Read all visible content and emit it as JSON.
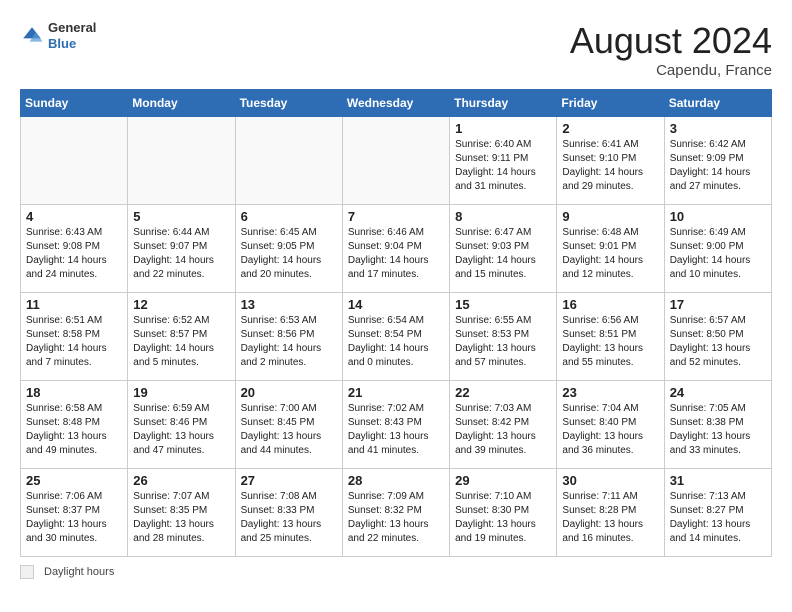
{
  "header": {
    "logo": {
      "general": "General",
      "blue": "Blue"
    },
    "month_year": "August 2024",
    "location": "Capendu, France"
  },
  "days_of_week": [
    "Sunday",
    "Monday",
    "Tuesday",
    "Wednesday",
    "Thursday",
    "Friday",
    "Saturday"
  ],
  "weeks": [
    [
      {
        "day": "",
        "info": ""
      },
      {
        "day": "",
        "info": ""
      },
      {
        "day": "",
        "info": ""
      },
      {
        "day": "",
        "info": ""
      },
      {
        "day": "1",
        "info": "Sunrise: 6:40 AM\nSunset: 9:11 PM\nDaylight: 14 hours and 31 minutes."
      },
      {
        "day": "2",
        "info": "Sunrise: 6:41 AM\nSunset: 9:10 PM\nDaylight: 14 hours and 29 minutes."
      },
      {
        "day": "3",
        "info": "Sunrise: 6:42 AM\nSunset: 9:09 PM\nDaylight: 14 hours and 27 minutes."
      }
    ],
    [
      {
        "day": "4",
        "info": "Sunrise: 6:43 AM\nSunset: 9:08 PM\nDaylight: 14 hours and 24 minutes."
      },
      {
        "day": "5",
        "info": "Sunrise: 6:44 AM\nSunset: 9:07 PM\nDaylight: 14 hours and 22 minutes."
      },
      {
        "day": "6",
        "info": "Sunrise: 6:45 AM\nSunset: 9:05 PM\nDaylight: 14 hours and 20 minutes."
      },
      {
        "day": "7",
        "info": "Sunrise: 6:46 AM\nSunset: 9:04 PM\nDaylight: 14 hours and 17 minutes."
      },
      {
        "day": "8",
        "info": "Sunrise: 6:47 AM\nSunset: 9:03 PM\nDaylight: 14 hours and 15 minutes."
      },
      {
        "day": "9",
        "info": "Sunrise: 6:48 AM\nSunset: 9:01 PM\nDaylight: 14 hours and 12 minutes."
      },
      {
        "day": "10",
        "info": "Sunrise: 6:49 AM\nSunset: 9:00 PM\nDaylight: 14 hours and 10 minutes."
      }
    ],
    [
      {
        "day": "11",
        "info": "Sunrise: 6:51 AM\nSunset: 8:58 PM\nDaylight: 14 hours and 7 minutes."
      },
      {
        "day": "12",
        "info": "Sunrise: 6:52 AM\nSunset: 8:57 PM\nDaylight: 14 hours and 5 minutes."
      },
      {
        "day": "13",
        "info": "Sunrise: 6:53 AM\nSunset: 8:56 PM\nDaylight: 14 hours and 2 minutes."
      },
      {
        "day": "14",
        "info": "Sunrise: 6:54 AM\nSunset: 8:54 PM\nDaylight: 14 hours and 0 minutes."
      },
      {
        "day": "15",
        "info": "Sunrise: 6:55 AM\nSunset: 8:53 PM\nDaylight: 13 hours and 57 minutes."
      },
      {
        "day": "16",
        "info": "Sunrise: 6:56 AM\nSunset: 8:51 PM\nDaylight: 13 hours and 55 minutes."
      },
      {
        "day": "17",
        "info": "Sunrise: 6:57 AM\nSunset: 8:50 PM\nDaylight: 13 hours and 52 minutes."
      }
    ],
    [
      {
        "day": "18",
        "info": "Sunrise: 6:58 AM\nSunset: 8:48 PM\nDaylight: 13 hours and 49 minutes."
      },
      {
        "day": "19",
        "info": "Sunrise: 6:59 AM\nSunset: 8:46 PM\nDaylight: 13 hours and 47 minutes."
      },
      {
        "day": "20",
        "info": "Sunrise: 7:00 AM\nSunset: 8:45 PM\nDaylight: 13 hours and 44 minutes."
      },
      {
        "day": "21",
        "info": "Sunrise: 7:02 AM\nSunset: 8:43 PM\nDaylight: 13 hours and 41 minutes."
      },
      {
        "day": "22",
        "info": "Sunrise: 7:03 AM\nSunset: 8:42 PM\nDaylight: 13 hours and 39 minutes."
      },
      {
        "day": "23",
        "info": "Sunrise: 7:04 AM\nSunset: 8:40 PM\nDaylight: 13 hours and 36 minutes."
      },
      {
        "day": "24",
        "info": "Sunrise: 7:05 AM\nSunset: 8:38 PM\nDaylight: 13 hours and 33 minutes."
      }
    ],
    [
      {
        "day": "25",
        "info": "Sunrise: 7:06 AM\nSunset: 8:37 PM\nDaylight: 13 hours and 30 minutes."
      },
      {
        "day": "26",
        "info": "Sunrise: 7:07 AM\nSunset: 8:35 PM\nDaylight: 13 hours and 28 minutes."
      },
      {
        "day": "27",
        "info": "Sunrise: 7:08 AM\nSunset: 8:33 PM\nDaylight: 13 hours and 25 minutes."
      },
      {
        "day": "28",
        "info": "Sunrise: 7:09 AM\nSunset: 8:32 PM\nDaylight: 13 hours and 22 minutes."
      },
      {
        "day": "29",
        "info": "Sunrise: 7:10 AM\nSunset: 8:30 PM\nDaylight: 13 hours and 19 minutes."
      },
      {
        "day": "30",
        "info": "Sunrise: 7:11 AM\nSunset: 8:28 PM\nDaylight: 13 hours and 16 minutes."
      },
      {
        "day": "31",
        "info": "Sunrise: 7:13 AM\nSunset: 8:27 PM\nDaylight: 13 hours and 14 minutes."
      }
    ]
  ],
  "footer": {
    "daylight_label": "Daylight hours"
  }
}
